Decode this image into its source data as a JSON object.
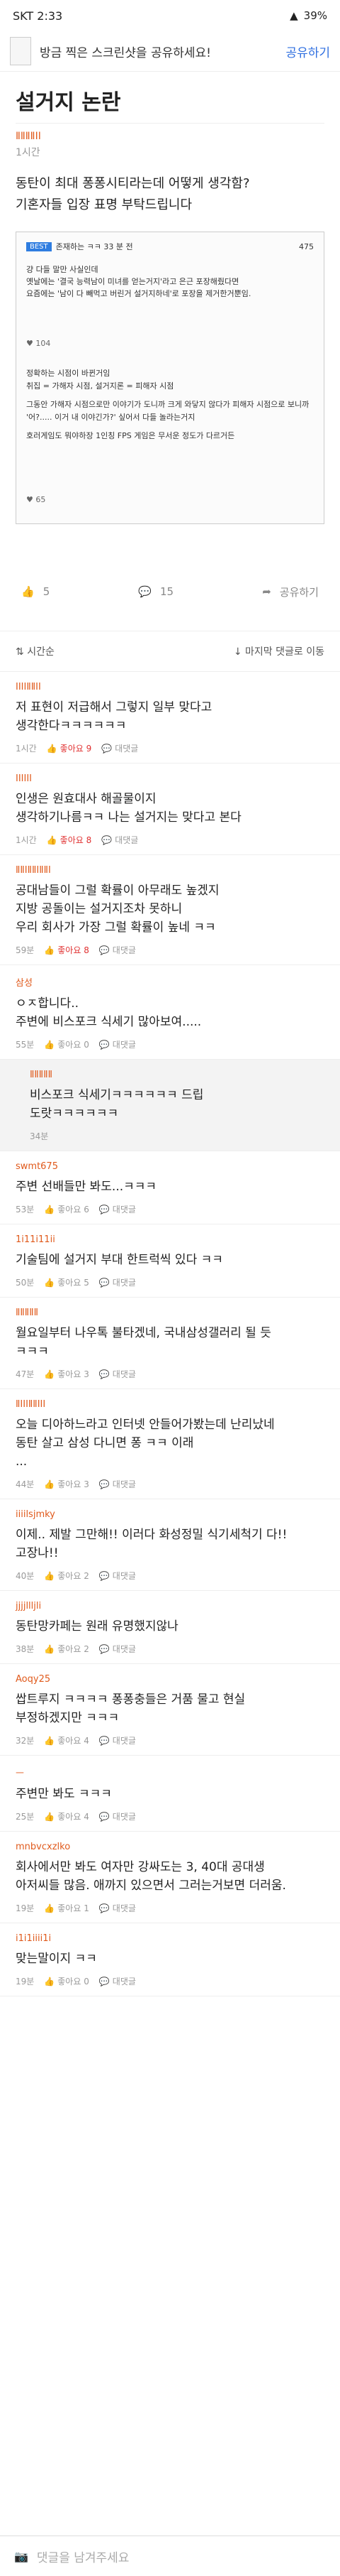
{
  "status": {
    "carrier_time": "SKT 2:33",
    "battery": "39%"
  },
  "share": {
    "message": "방금 찍은 스크린샷을 공유하세요!",
    "button": "공유하기"
  },
  "post": {
    "title": "설거지 논란",
    "author": "ⅡⅡⅡⅡⅠⅠ",
    "time": "1시간",
    "body": "동탄이 최대 퐁퐁시티라는데 어떻게 생각함?\n기혼자들 입장 표명 부탁드립니다",
    "image": {
      "badge": "BEST",
      "header": "존재하는 ㅋㅋ 33 분 전",
      "views": "475",
      "lines": [
        "걍 다들 말만 사실인데",
        "옛날에는 '결국 능력남이 미녀를 얻는거지'라고 은근 포장해줬다면",
        "요즘에는 '남이 다 빼먹고 버린거 설거지하네'로 포장을 제거한거뿐임."
      ],
      "likes1": "104",
      "lines2": [
        "정확하는 시점이 바뀐거임",
        "취집 = 가해자 시점, 설거지론 = 피해자 시점",
        "그동안 가해자 시점으로만 이야기가 도니까 크게 와닿지 않다가 피해자 시점으로 보니까 '어?..... 이거 내 이야긴가?' 싶어서 다들 놀라는거지",
        "호러게임도 뭐야하장 1인칭 FPS 게임은 무서운 정도가 다르거든"
      ],
      "likes2": "65"
    },
    "actions": {
      "likes": "5",
      "comments": "15",
      "share": "공유하기"
    }
  },
  "sort": {
    "left": "시간순",
    "right": "마지막 댓글로 이동"
  },
  "comments": [
    {
      "author": "ⅠⅠⅠⅠⅡⅡⅠⅠ",
      "text": "저 표현이 저급해서 그렇지 일부 맞다고\n생각한다ㅋㅋㅋㅋㅋㅋ",
      "time": "1시간",
      "likes": "좋아요 9",
      "reply": "대댓글",
      "red": true
    },
    {
      "author": "ⅠⅠⅠⅠⅠⅠ",
      "text": "인생은 원효대사 해골물이지\n생각하기나름ㅋㅋ 나는 설거지는 맞다고 본다",
      "time": "1시간",
      "likes": "좋아요 8",
      "reply": "대댓글",
      "red": true
    },
    {
      "author": "ⅡⅡⅠⅡⅡⅠⅡⅡⅠ",
      "text": "공대남들이 그럴 확률이 아무래도 높겠지\n지방 공돌이는 설거지조차 못하니\n우리 회사가 가장 그럴 확률이 높네 ㅋㅋ",
      "time": "59분",
      "likes": "좋아요 8",
      "reply": "대댓글",
      "red": true
    },
    {
      "author": "삼성",
      "text": "ㅇㅈ합니다..\n주변에 비스포크 식세기 많아보여.....",
      "time": "55분",
      "likes": "좋아요 0",
      "reply": "대댓글",
      "red": false
    },
    {
      "author": "ⅡⅡⅡⅡⅡ",
      "text": "비스포크 식세기ㅋㅋㅋㅋㅋㅋ 드립\n도랏ㅋㅋㅋㅋㅋㅋ",
      "time": "34분",
      "likes": "",
      "reply": "",
      "red": false,
      "is_reply": true
    },
    {
      "author": "swmt675",
      "text": "주변 선배들만 봐도...ㅋㅋㅋ",
      "time": "53분",
      "likes": "좋아요 6",
      "reply": "대댓글",
      "red": false
    },
    {
      "author": "1i11i11ii",
      "text": "기술팀에 설거지 부대 한트럭씩 있다 ㅋㅋ",
      "time": "50분",
      "likes": "좋아요 5",
      "reply": "대댓글",
      "red": false
    },
    {
      "author": "ⅡⅡⅡⅡⅡ",
      "text": "월요일부터 나우톡 불타겠네, 국내삼성갤러리 될 듯\nㅋㅋㅋ",
      "time": "47분",
      "likes": "좋아요 3",
      "reply": "대댓글",
      "red": false
    },
    {
      "author": "ⅡⅠⅠⅠⅡⅡⅠⅠⅠ",
      "text": "오늘 디아하느라고 인터넷 안들어가봤는데 난리났네\n동탄 살고 삼성 다니면 퐁 ㅋㅋ 이래\n...",
      "time": "44분",
      "likes": "좋아요 3",
      "reply": "대댓글",
      "red": false
    },
    {
      "author": "iiiilsjmky",
      "text": "이제.. 제발 그만해!! 이러다 화성정밀 식기세척기 다!!\n고장나!!",
      "time": "40분",
      "likes": "좋아요 2",
      "reply": "대댓글",
      "red": false
    },
    {
      "author": "jjjjllljli",
      "text": "동탄망카페는 원래 유명했지않나",
      "time": "38분",
      "likes": "좋아요 2",
      "reply": "대댓글",
      "red": false
    },
    {
      "author": "Aoqy25",
      "text": "쌉트루지 ㅋㅋㅋㅋ 퐁퐁충들은 거품 물고 현실\n부정하겠지만 ㅋㅋㅋ",
      "time": "32분",
      "likes": "좋아요 4",
      "reply": "대댓글",
      "red": false
    },
    {
      "author": "ㅡ",
      "text": "주변만 봐도 ㅋㅋㅋ",
      "time": "25분",
      "likes": "좋아요 4",
      "reply": "대댓글",
      "red": false
    },
    {
      "author": "mnbvcxzlko",
      "text": "회사에서만 봐도 여자만 강싸도는 3, 40대 공대생\n아저씨들 많음. 애까지 있으면서 그러는거보면 더러움.",
      "time": "19분",
      "likes": "좋아요 1",
      "reply": "대댓글",
      "red": false
    },
    {
      "author": "i1i1iiii1i",
      "text": "맞는말이지 ㅋㅋ",
      "time": "19분",
      "likes": "좋아요 0",
      "reply": "대댓글",
      "red": false
    }
  ],
  "input": {
    "placeholder": "댓글을 남겨주세요"
  }
}
